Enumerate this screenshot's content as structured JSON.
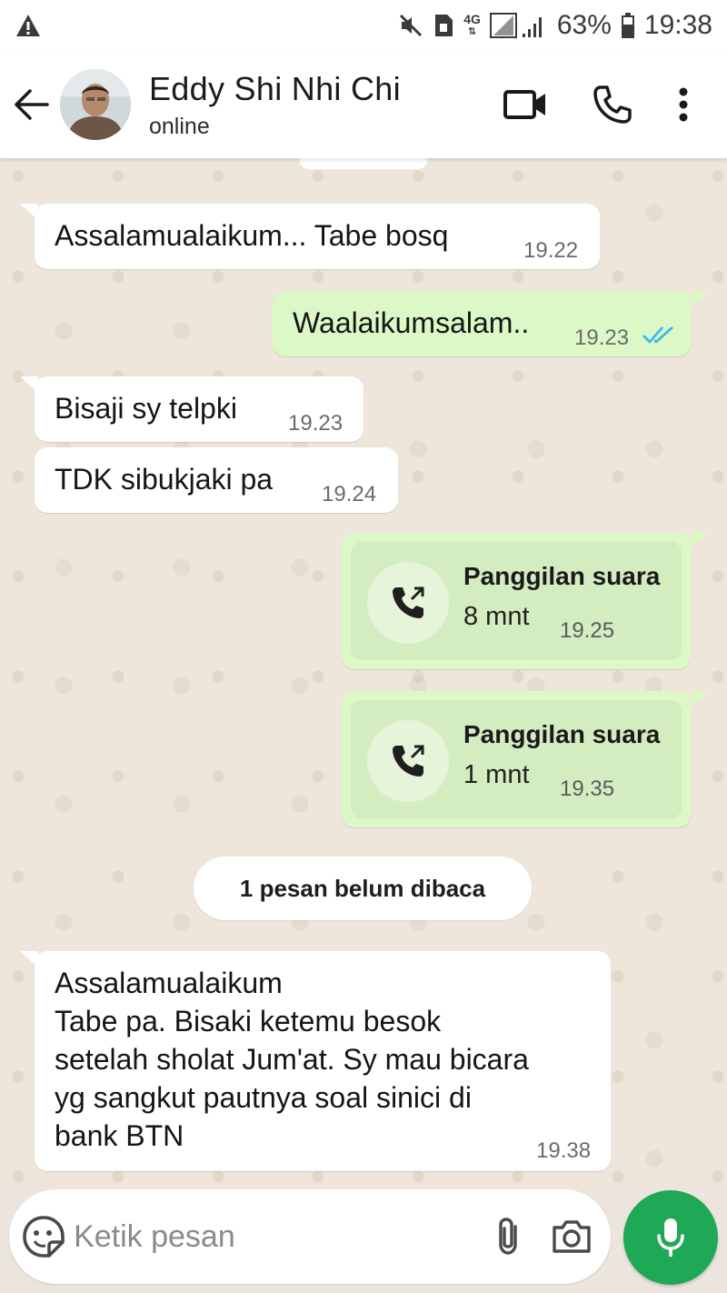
{
  "status_bar": {
    "network": "4G",
    "battery_percent": "63%",
    "time": "19:38",
    "icons": [
      "warning-icon",
      "mute-icon",
      "sim-icon",
      "signal-icon",
      "battery-icon"
    ]
  },
  "header": {
    "contact_name": "Eddy Shi Nhi Chi",
    "status": "online",
    "icons": [
      "back-arrow-icon",
      "video-call-icon",
      "voice-call-icon",
      "more-options-icon"
    ]
  },
  "messages": [
    {
      "direction": "in",
      "text": "Assalamualaikum... Tabe bosq",
      "time": "19.22"
    },
    {
      "direction": "out",
      "text": "Waalaikumsalam..",
      "time": "19.23",
      "read": true
    },
    {
      "direction": "in",
      "text": "Bisaji sy telpki",
      "time": "19.23"
    },
    {
      "direction": "in",
      "text": "TDK sibukjaki pa",
      "time": "19.24"
    },
    {
      "direction": "out",
      "type": "call",
      "title": "Panggilan suara",
      "duration": "8 mnt",
      "time": "19.25"
    },
    {
      "direction": "out",
      "type": "call",
      "title": "Panggilan suara",
      "duration": "1 mnt",
      "time": "19.35"
    },
    {
      "direction": "in",
      "text": "Assalamualaikum\nTabe pa. Bisaki ketemu besok\nsetelah sholat Jum'at. Sy mau bicara\nyg sangkut pautnya soal sinici  di\nbank BTN",
      "time": "19.38"
    }
  ],
  "unread_banner": "1 pesan belum dibaca",
  "composer": {
    "placeholder": "Ketik pesan",
    "icons": [
      "sticker-icon",
      "attach-icon",
      "camera-icon",
      "mic-icon"
    ]
  },
  "colors": {
    "outgoing_bubble": "#dcf8c6",
    "incoming_bubble": "#ffffff",
    "chat_background": "#eee6da",
    "mic_button": "#1fa855",
    "read_ticks": "#34b7f1"
  }
}
